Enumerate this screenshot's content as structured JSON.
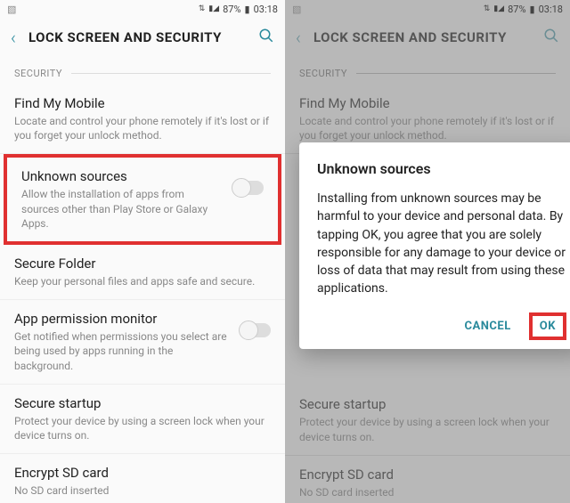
{
  "status": {
    "battery_pct": "87%",
    "time": "03:18"
  },
  "header": {
    "title": "LOCK SCREEN AND SECURITY"
  },
  "section": {
    "label": "SECURITY"
  },
  "items": {
    "find_my_mobile": {
      "title": "Find My Mobile",
      "sub": "Locate and control your phone remotely if it's lost or if you forget your unlock method."
    },
    "unknown_sources": {
      "title": "Unknown sources",
      "sub": "Allow the installation of apps from sources other than Play Store or Galaxy Apps."
    },
    "secure_folder": {
      "title": "Secure Folder",
      "sub": "Keep your personal files and apps safe and secure."
    },
    "app_permission": {
      "title": "App permission monitor",
      "sub": "Get notified when permissions you select are being used by apps running in the background."
    },
    "secure_startup": {
      "title": "Secure startup",
      "sub": "Protect your device by using a screen lock when your device turns on."
    },
    "encrypt_sd": {
      "title": "Encrypt SD card",
      "sub": "No SD card inserted"
    }
  },
  "dialog": {
    "title": "Unknown sources",
    "body": "Installing from unknown sources may be harmful to your device and personal data. By tapping OK, you agree that you are solely responsible for any damage to your device or loss of data that may result from using these applications.",
    "cancel": "CANCEL",
    "ok": "OK"
  }
}
